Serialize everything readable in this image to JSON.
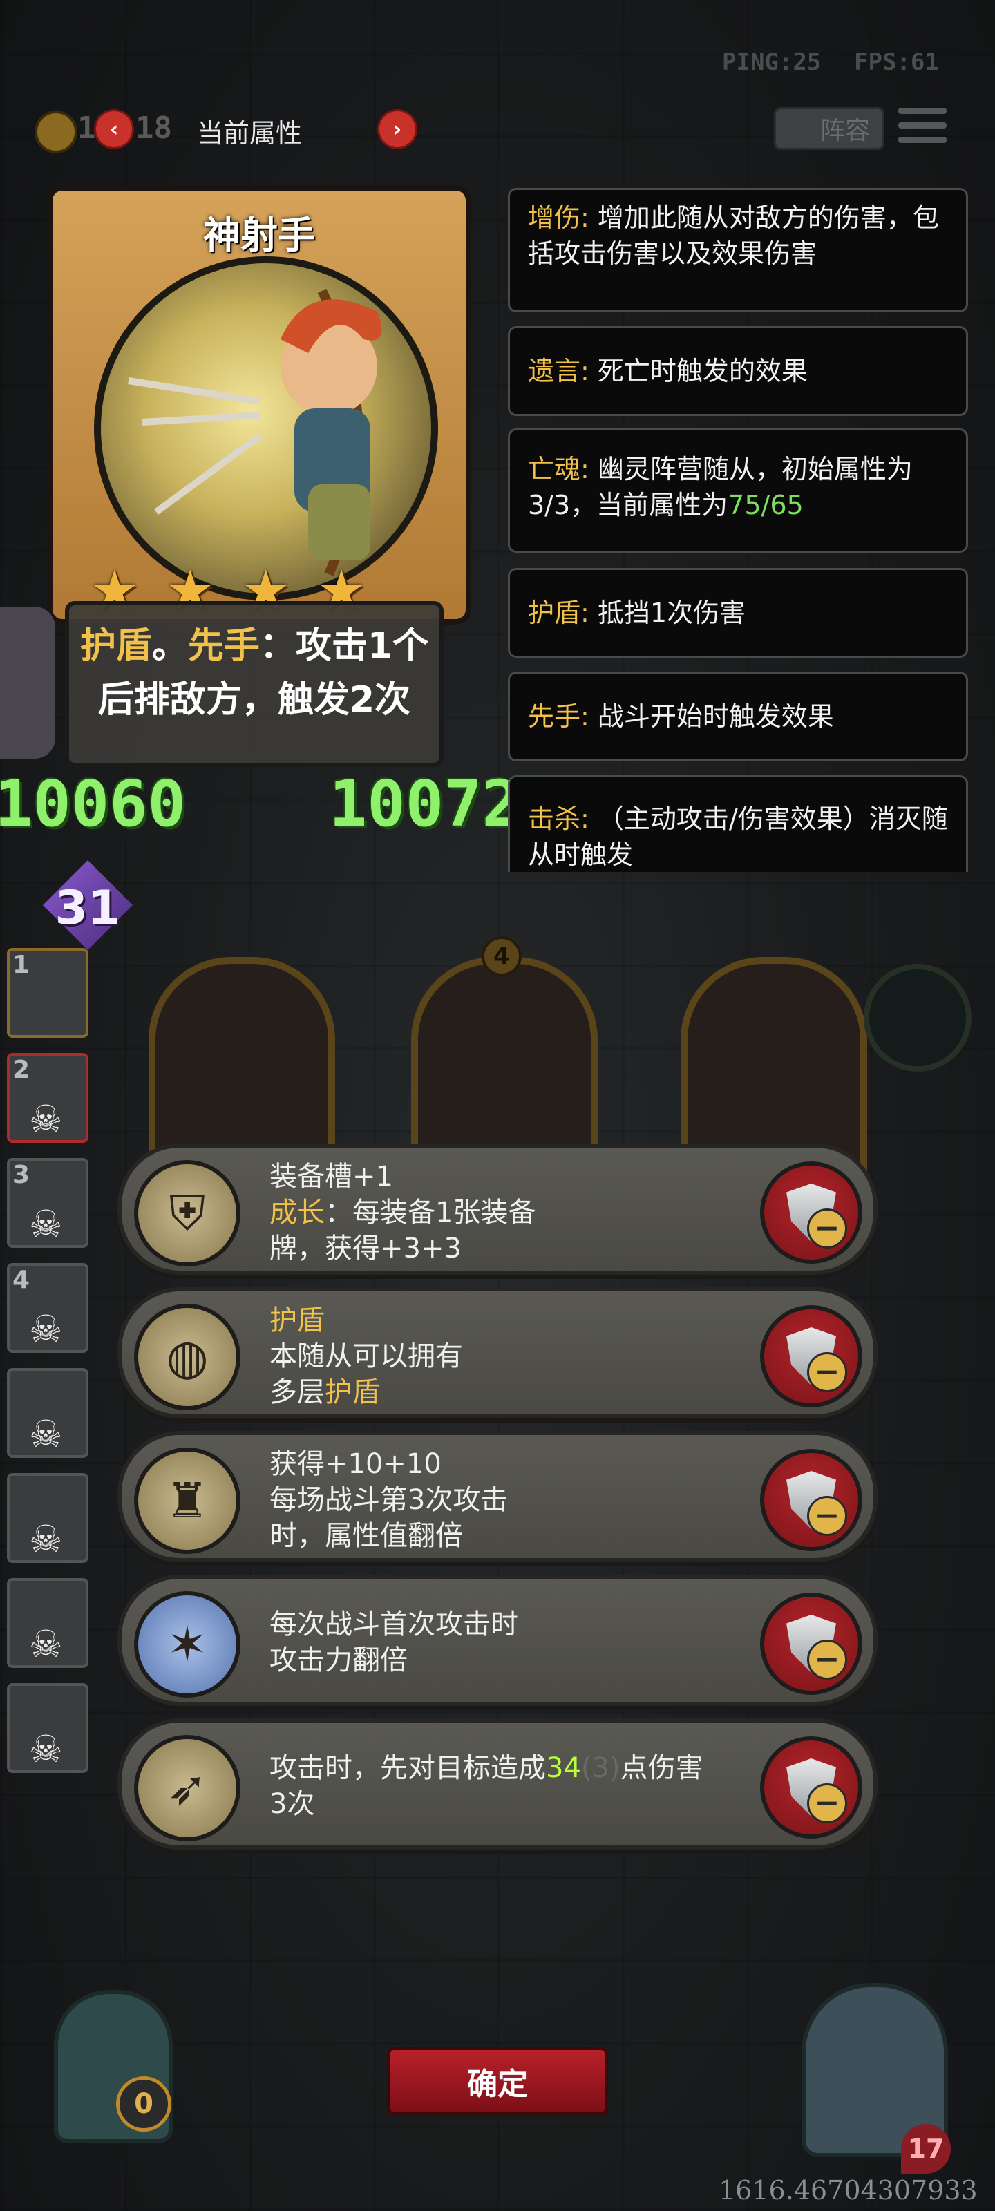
{
  "hud": {
    "ping": "PING:25",
    "fps": "FPS:61",
    "coins_partial": "1",
    "coins_tail": "18",
    "current_attr_title": "当前属性",
    "prev_arrow": "‹",
    "next_arrow": "›",
    "lineup_button": "阵容",
    "menu_icon": "menu-icon"
  },
  "card": {
    "name": "神射手",
    "stars": 4,
    "star_glyphs": [
      "★",
      "★",
      "★",
      "★"
    ],
    "desc_kw1": "护盾",
    "desc_sep1": "。",
    "desc_kw2": "先手",
    "desc_rest_line1": "：攻击1个",
    "desc_line2": "后排敌方，触发2次"
  },
  "stats": {
    "left_value": "10060",
    "right_value": "10072",
    "level": "31"
  },
  "tooltips": [
    {
      "keyword": "增伤",
      "colon": ":",
      "text": " 增加此随从对敌方的伤害，包括攻击伤害以及效果伤害"
    },
    {
      "keyword": "遗言",
      "colon": ":",
      "text": " 死亡时触发的效果"
    },
    {
      "keyword": "亡魂",
      "colon": ":",
      "text_a": " 幽灵阵营随从，初始属性为3/3，当前属性为",
      "highlight": "75/65"
    },
    {
      "keyword": "护盾",
      "colon": ":",
      "text": " 抵挡1次伤害"
    },
    {
      "keyword": "先手",
      "colon": ":",
      "text": " 战斗开始时触发效果"
    },
    {
      "keyword": "击杀",
      "colon": ":",
      "text": " （主动攻击/伤害效果）消灭随从时触发"
    }
  ],
  "lineup_slots": [
    {
      "num": "1"
    },
    {
      "num": "2"
    },
    {
      "num": "3"
    },
    {
      "num": "4"
    },
    {
      "num": ""
    },
    {
      "num": ""
    },
    {
      "num": ""
    },
    {
      "num": ""
    }
  ],
  "board": {
    "center_badge": "4"
  },
  "items": [
    {
      "icon": "armor-icon",
      "line1": "装备槽+1",
      "kw": "成长",
      "line2_rest": "：每装备1张装备",
      "line3": "牌，获得+3+3"
    },
    {
      "icon": "mirror-icon",
      "kw_title": "护盾",
      "line2": "本随从可以拥有",
      "line3_prefix": "多层",
      "line3_kw": "护盾"
    },
    {
      "icon": "cloak-figure-icon",
      "line1": "获得+10+10",
      "line2": "每场战斗第3次攻击",
      "line3": "时，属性值翻倍"
    },
    {
      "icon": "dragon-icon",
      "line1": "每次战斗首次攻击时",
      "line2": "攻击力翻倍"
    },
    {
      "icon": "crossbow-icon",
      "line1_prefix": "攻击时，先对目标造成",
      "line1_value": "34",
      "line1_faded": "(3)",
      "line1_suffix": "点伤害",
      "line2": "3次"
    }
  ],
  "confirm_label": "确定",
  "bottom": {
    "coord_readout": "1616.46704307933",
    "left_badge": "0",
    "right_badge": "17"
  },
  "colors": {
    "keyword_gold": "#f1c14a",
    "stat_green": "#8ef06b",
    "highlight_green": "#b6ff3b",
    "button_red": "#b8202a"
  }
}
